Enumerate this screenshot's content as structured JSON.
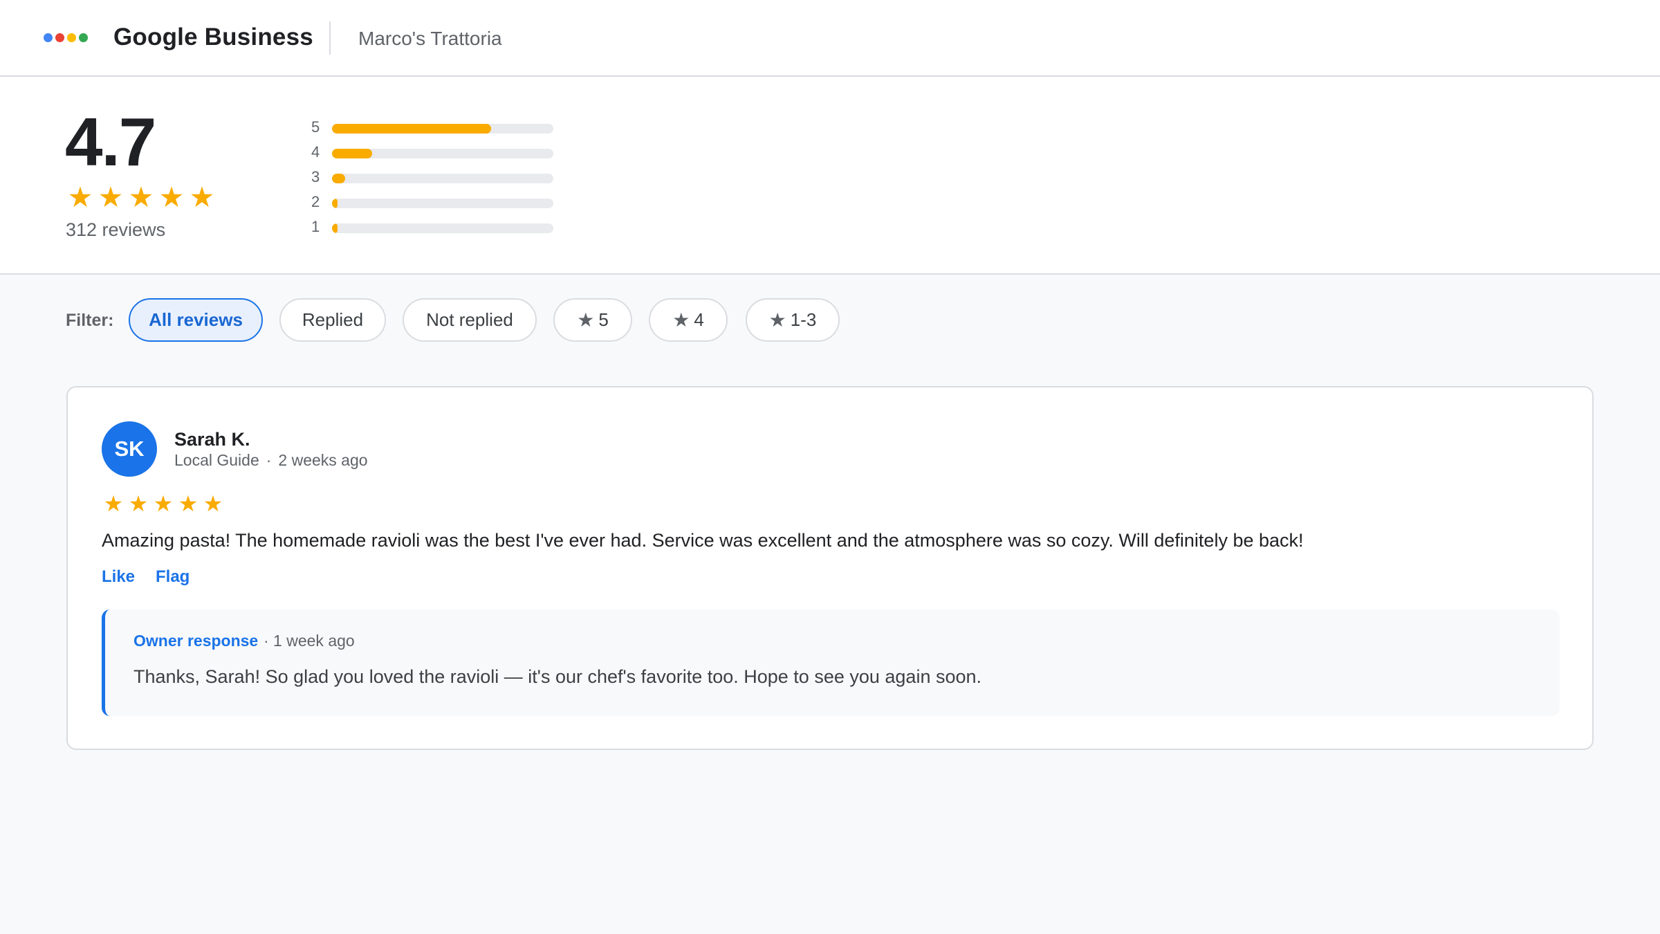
{
  "header": {
    "brand": "Google Business",
    "business_name": "Marco's Trattoria",
    "logo_colors": [
      "#4285f4",
      "#ea4335",
      "#fbbc04",
      "#34a853"
    ]
  },
  "summary": {
    "average": "4.7",
    "star_count": 5,
    "reviews_label": "312 reviews",
    "distribution": [
      {
        "label": "5",
        "fraction": 0.72
      },
      {
        "label": "4",
        "fraction": 0.18
      },
      {
        "label": "3",
        "fraction": 0.06
      },
      {
        "label": "2",
        "fraction": 0.02
      },
      {
        "label": "1",
        "fraction": 0.02
      }
    ]
  },
  "filter": {
    "label": "Filter:",
    "chips": [
      {
        "label": "All reviews",
        "active": true,
        "star": false
      },
      {
        "label": "Replied",
        "active": false,
        "star": false
      },
      {
        "label": "Not replied",
        "active": false,
        "star": false
      },
      {
        "label": "5",
        "active": false,
        "star": true
      },
      {
        "label": "4",
        "active": false,
        "star": true
      },
      {
        "label": "1-3",
        "active": false,
        "star": true
      }
    ]
  },
  "review": {
    "initials": "SK",
    "name": "Sarah K.",
    "badge": "Local Guide",
    "separator": "·",
    "time": "2 weeks ago",
    "rating": 5,
    "text": "Amazing pasta! The homemade ravioli was the best I've ever had. Service was excellent and the atmosphere was so cozy. Will definitely be back!",
    "like_label": "Like",
    "flag_label": "Flag",
    "response": {
      "label": "Owner response",
      "time": "· 1 week ago",
      "text": "Thanks, Sarah! So glad you loved the ravioli — it's our chef's favorite too. Hope to see you again soon."
    }
  },
  "colors": {
    "accent": "#1a73e8",
    "star": "#f9ab00",
    "track": "#e8eaed"
  }
}
